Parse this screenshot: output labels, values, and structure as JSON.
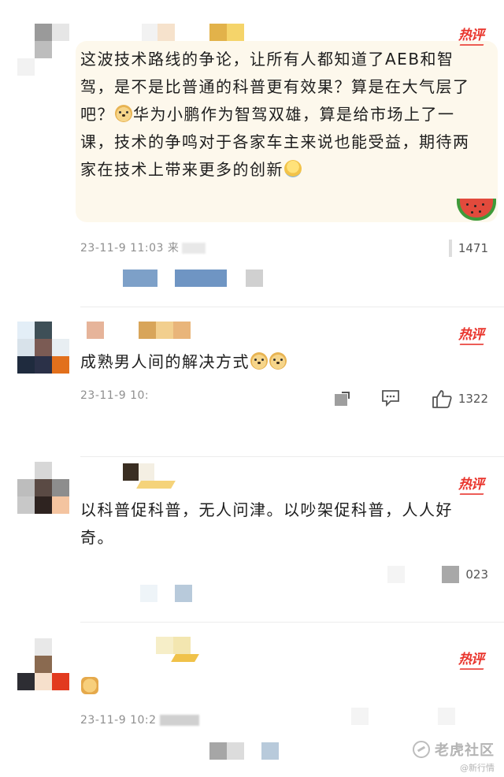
{
  "comments": [
    {
      "badge": "热评",
      "text_parts": [
        "这波技术路线的争论，让所有人都知道了AEB和智驾，是不是比普通的科普更有效果？算是在大气层了吧？",
        "华为小鹏作为智驾双雄，算是给市场上了一课，技术的争鸣对于各家车主来说也能受益，期待两家在技术上带来更多的创新"
      ],
      "meta": "23-11-9 11:03  来",
      "likes": "1471"
    },
    {
      "badge": "热评",
      "text": "成熟男人间的解决方式",
      "meta": "23-11-9 10:",
      "likes": "1322"
    },
    {
      "badge": "热评",
      "text": "以科普促科普，无人问津。以吵架促科普，人人好奇。",
      "likes": "023"
    },
    {
      "badge": "热评",
      "meta": "23-11-9 10:2"
    }
  ],
  "icons": {
    "share": "share-icon",
    "comment": "comment-icon",
    "like": "thumbs-up-icon"
  },
  "watermark": {
    "brand": "老虎社区",
    "sub": "@新行情"
  },
  "colors": {
    "hot": "#e9352d",
    "meta": "#8f8f8f"
  }
}
